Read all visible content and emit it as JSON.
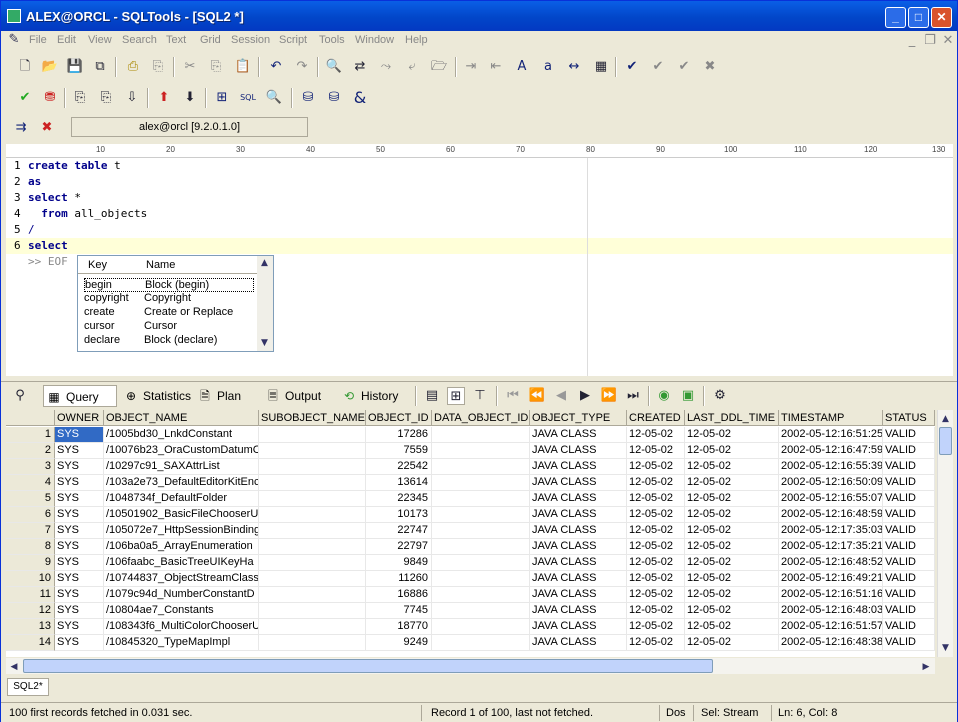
{
  "window": {
    "title": "ALEX@ORCL - SQLTools - [SQL2 *]"
  },
  "menu": [
    "File",
    "Edit",
    "View",
    "Search",
    "Text",
    "Grid",
    "Session",
    "Script",
    "Tools",
    "Window",
    "Help"
  ],
  "connection": {
    "label": "alex@orcl [9.2.0.1.0]"
  },
  "ruler": {
    "marks": [
      "10",
      "20",
      "30",
      "40",
      "50",
      "60",
      "70",
      "80",
      "90",
      "100",
      "110",
      "120",
      "130"
    ]
  },
  "editor": {
    "lines": [
      {
        "num": "1",
        "kw": "create table",
        "rest": " t"
      },
      {
        "num": "2",
        "kw": "as",
        "rest": ""
      },
      {
        "num": "3",
        "kw": "select",
        "rest": " *"
      },
      {
        "num": "4",
        "kw": "  from",
        "rest": " all_objects"
      },
      {
        "num": "5",
        "kw": "",
        "rest": "/"
      },
      {
        "num": "6",
        "kw": "select",
        "rest": ""
      }
    ],
    "eof": ">> EOF"
  },
  "completion": {
    "header_key": "Key",
    "header_name": "Name",
    "items": [
      {
        "key": "begin",
        "name": "Block (begin)"
      },
      {
        "key": "copyright",
        "name": "Copyright"
      },
      {
        "key": "create",
        "name": "Create or Replace"
      },
      {
        "key": "cursor",
        "name": "Cursor"
      },
      {
        "key": "declare",
        "name": "Block (declare)"
      }
    ]
  },
  "result_tabs": [
    {
      "label": "Query",
      "icon": "grid-icon"
    },
    {
      "label": "Statistics",
      "icon": "statistics-icon"
    },
    {
      "label": "Plan",
      "icon": "plan-icon"
    },
    {
      "label": "Output",
      "icon": "output-icon"
    },
    {
      "label": "History",
      "icon": "history-icon"
    }
  ],
  "grid": {
    "columns": [
      "OWNER",
      "OBJECT_NAME",
      "SUBOBJECT_NAME",
      "OBJECT_ID",
      "DATA_OBJECT_ID",
      "OBJECT_TYPE",
      "CREATED",
      "LAST_DDL_TIME",
      "TIMESTAMP",
      "STATUS"
    ],
    "rows": [
      [
        "1",
        "SYS",
        "/1005bd30_LnkdConstant",
        "",
        "17286",
        "",
        "JAVA CLASS",
        "12-05-02",
        "12-05-02",
        "2002-05-12:16:51:25",
        "VALID"
      ],
      [
        "2",
        "SYS",
        "/10076b23_OraCustomDatumC",
        "",
        "7559",
        "",
        "JAVA CLASS",
        "12-05-02",
        "12-05-02",
        "2002-05-12:16:47:59",
        "VALID"
      ],
      [
        "3",
        "SYS",
        "/10297c91_SAXAttrList",
        "",
        "22542",
        "",
        "JAVA CLASS",
        "12-05-02",
        "12-05-02",
        "2002-05-12:16:55:39",
        "VALID"
      ],
      [
        "4",
        "SYS",
        "/103a2e73_DefaultEditorKitEnc",
        "",
        "13614",
        "",
        "JAVA CLASS",
        "12-05-02",
        "12-05-02",
        "2002-05-12:16:50:09",
        "VALID"
      ],
      [
        "5",
        "SYS",
        "/1048734f_DefaultFolder",
        "",
        "22345",
        "",
        "JAVA CLASS",
        "12-05-02",
        "12-05-02",
        "2002-05-12:16:55:07",
        "VALID"
      ],
      [
        "6",
        "SYS",
        "/10501902_BasicFileChooserU",
        "",
        "10173",
        "",
        "JAVA CLASS",
        "12-05-02",
        "12-05-02",
        "2002-05-12:16:48:59",
        "VALID"
      ],
      [
        "7",
        "SYS",
        "/105072e7_HttpSessionBinding",
        "",
        "22747",
        "",
        "JAVA CLASS",
        "12-05-02",
        "12-05-02",
        "2002-05-12:17:35:03",
        "VALID"
      ],
      [
        "8",
        "SYS",
        "/106ba0a5_ArrayEnumeration",
        "",
        "22797",
        "",
        "JAVA CLASS",
        "12-05-02",
        "12-05-02",
        "2002-05-12:17:35:21",
        "VALID"
      ],
      [
        "9",
        "SYS",
        "/106faabc_BasicTreeUIKeyHa",
        "",
        "9849",
        "",
        "JAVA CLASS",
        "12-05-02",
        "12-05-02",
        "2002-05-12:16:48:52",
        "VALID"
      ],
      [
        "10",
        "SYS",
        "/10744837_ObjectStreamClass",
        "",
        "11260",
        "",
        "JAVA CLASS",
        "12-05-02",
        "12-05-02",
        "2002-05-12:16:49:21",
        "VALID"
      ],
      [
        "11",
        "SYS",
        "/1079c94d_NumberConstantD",
        "",
        "16886",
        "",
        "JAVA CLASS",
        "12-05-02",
        "12-05-02",
        "2002-05-12:16:51:16",
        "VALID"
      ],
      [
        "12",
        "SYS",
        "/10804ae7_Constants",
        "",
        "7745",
        "",
        "JAVA CLASS",
        "12-05-02",
        "12-05-02",
        "2002-05-12:16:48:03",
        "VALID"
      ],
      [
        "13",
        "SYS",
        "/108343f6_MultiColorChooserU",
        "",
        "18770",
        "",
        "JAVA CLASS",
        "12-05-02",
        "12-05-02",
        "2002-05-12:16:51:57",
        "VALID"
      ],
      [
        "14",
        "SYS",
        "/10845320_TypeMapImpl",
        "",
        "9249",
        "",
        "JAVA CLASS",
        "12-05-02",
        "12-05-02",
        "2002-05-12:16:48:38",
        "VALID"
      ]
    ]
  },
  "doc_tab": "SQL2*",
  "status": {
    "fetch": "100 first records fetched in 0.031 sec.",
    "record": "Record 1 of 100, last not fetched.",
    "eol": "Dos",
    "sel": "Sel: Stream",
    "pos": "Ln: 6, Col: 8"
  }
}
